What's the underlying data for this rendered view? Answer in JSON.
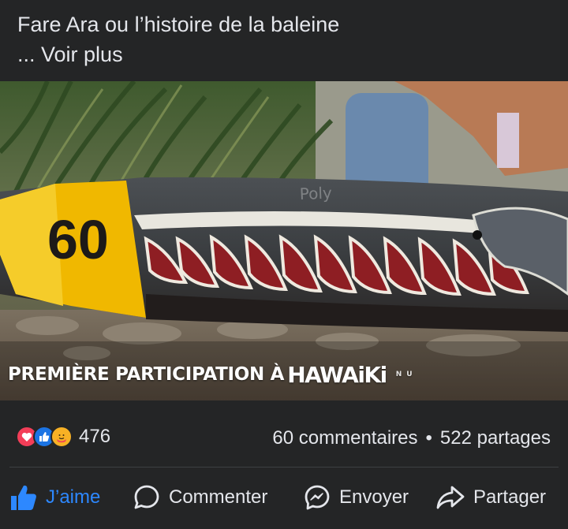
{
  "post": {
    "title": "Fare Ara ou l’histoire de la baleine",
    "see_more": "... Voir plus"
  },
  "media": {
    "bib_number": "60",
    "caption_main": "PREMIÈRE PARTICIPATION À",
    "caption_brand": "HAWAiKi",
    "caption_brand_small": "NU"
  },
  "stats": {
    "reaction_count": "476",
    "comments": "60 commentaires",
    "separator": "•",
    "shares": "522 partages"
  },
  "actions": {
    "like": "J’aime",
    "comment": "Commenter",
    "send": "Envoyer",
    "share": "Partager"
  },
  "colors": {
    "background": "#242526",
    "text": "#e4e6eb",
    "like_blue": "#2d88ff",
    "love_red": "#f33e58",
    "care_yellow": "#f7b125"
  }
}
